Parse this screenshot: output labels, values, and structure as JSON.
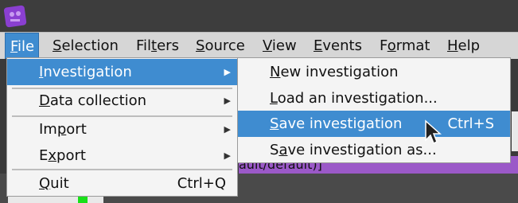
{
  "menubar": {
    "items": [
      {
        "label": "File",
        "mnemonic": "F"
      },
      {
        "label": "Selection",
        "mnemonic": "S"
      },
      {
        "label": "Filters",
        "mnemonic": "t"
      },
      {
        "label": "Source",
        "mnemonic": "S"
      },
      {
        "label": "View",
        "mnemonic": "V"
      },
      {
        "label": "Events",
        "mnemonic": "E"
      },
      {
        "label": "Format",
        "mnemonic": "o"
      },
      {
        "label": "Help",
        "mnemonic": "H"
      }
    ]
  },
  "file_menu": {
    "items": [
      {
        "label": "Investigation",
        "has_submenu": true,
        "selected": true
      },
      {
        "label": "Data collection",
        "has_submenu": true
      },
      {
        "label": "Import",
        "has_submenu": true
      },
      {
        "label": "Export",
        "has_submenu": true
      },
      {
        "label": "Quit",
        "shortcut": "Ctrl+Q"
      }
    ]
  },
  "investigation_menu": {
    "items": [
      {
        "label": "New investigation"
      },
      {
        "label": "Load an investigation..."
      },
      {
        "label": "Save investigation",
        "shortcut": "Ctrl+S",
        "selected": true
      },
      {
        "label": "Save investigation as..."
      }
    ]
  },
  "background": {
    "status_text": "ault/default)]"
  },
  "colors": {
    "accent": "#3f8cd0",
    "menu_bg": "#f4f4f4",
    "status_bar": "#9b59c8"
  }
}
